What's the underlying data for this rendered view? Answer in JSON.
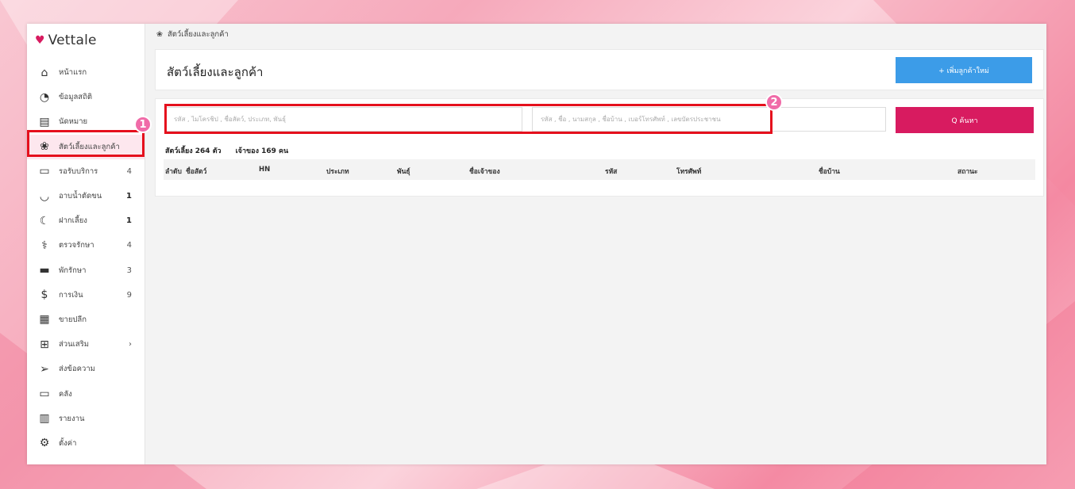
{
  "app": {
    "name": "Vettale"
  },
  "breadcrumb": {
    "label": "สัตว์เลี้ยงและลูกค้า"
  },
  "sidebar": {
    "items": [
      {
        "label": "หน้าแรก",
        "icon": "home-icon",
        "glyph": "⌂",
        "count": ""
      },
      {
        "label": "ข้อมูลสถิติ",
        "icon": "dashboard-icon",
        "glyph": "◔",
        "count": ""
      },
      {
        "label": "นัดหมาย",
        "icon": "calendar-icon",
        "glyph": "▤",
        "count": ""
      },
      {
        "label": "สัตว์เลี้ยงและลูกค้า",
        "icon": "paw-icon",
        "glyph": "❀",
        "count": ""
      },
      {
        "label": "รอรับบริการ",
        "icon": "sofa-icon",
        "glyph": "▭",
        "count": "4"
      },
      {
        "label": "อาบน้ำตัดขน",
        "icon": "bathtub-icon",
        "glyph": "◡",
        "count": "1"
      },
      {
        "label": "ฝากเลี้ยง",
        "icon": "moon-icon",
        "glyph": "☾",
        "count": "1"
      },
      {
        "label": "ตรวจรักษา",
        "icon": "stethoscope-icon",
        "glyph": "⚕",
        "count": "4"
      },
      {
        "label": "พักรักษา",
        "icon": "bed-icon",
        "glyph": "▬",
        "count": "3"
      },
      {
        "label": "การเงิน",
        "icon": "money-icon",
        "glyph": "$",
        "count": "9"
      },
      {
        "label": "ขายปลีก",
        "icon": "register-icon",
        "glyph": "▦",
        "count": ""
      },
      {
        "label": "ส่วนเสริม",
        "icon": "plus-box-icon",
        "glyph": "⊞",
        "count": "›"
      },
      {
        "label": "ส่งข้อความ",
        "icon": "send-icon",
        "glyph": "➢",
        "count": ""
      },
      {
        "label": "คลัง",
        "icon": "archive-icon",
        "glyph": "▭",
        "count": ""
      },
      {
        "label": "รายงาน",
        "icon": "report-icon",
        "glyph": "▥",
        "count": ""
      },
      {
        "label": "ตั้งค่า",
        "icon": "gear-icon",
        "glyph": "⚙",
        "count": ""
      }
    ]
  },
  "header": {
    "title": "สัตว์เลี้ยงและลูกค้า",
    "add_button": "+ เพิ่มลูกค้าใหม่"
  },
  "search": {
    "pet_placeholder": "รหัส , ไมโครชิป , ชื่อสัตว์, ประเภท, พันธุ์",
    "owner_placeholder": "รหัส , ชื่อ , นามสกุล , ชื่อบ้าน , เบอร์โทรศัพท์ , เลขบัตรประชาชน",
    "search_button": "Q ค้นหา"
  },
  "stats": {
    "pets": "สัตว์เลี้ยง 264 ตัว",
    "owners": "เจ้าของ 169 คน"
  },
  "table": {
    "columns": [
      "ลำดับ",
      "ชื่อสัตว์",
      "HN",
      "ประเภท",
      "พันธุ์",
      "ชื่อเจ้าของ",
      "รหัส",
      "โทรศัพท์",
      "ชื่อบ้าน",
      "สถานะ"
    ]
  },
  "annotations": {
    "marker1": "1",
    "marker2": "2"
  },
  "colors": {
    "primary": "#3c9ce8",
    "accent": "#d81b60",
    "highlight": "#e5101d"
  }
}
